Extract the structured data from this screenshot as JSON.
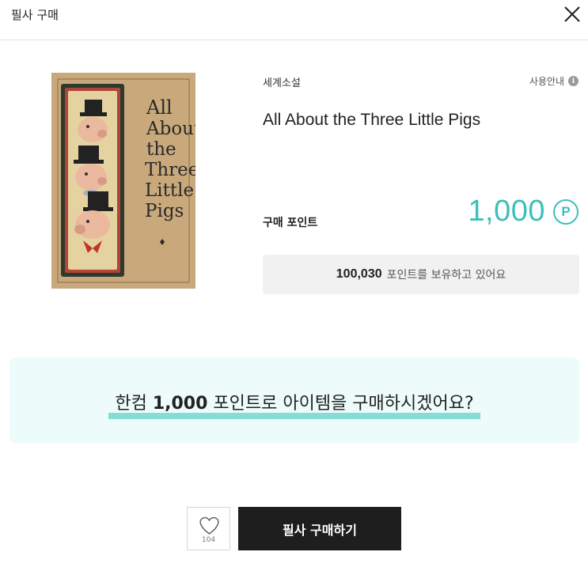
{
  "header": {
    "title": "필사 구매"
  },
  "book": {
    "category": "세계소설",
    "title": "All About the Three Little Pigs",
    "cover_text": [
      "All",
      "About",
      "the",
      "Three",
      "Little",
      "Pigs"
    ]
  },
  "usage_guide": {
    "label": "사용안내",
    "icon": "info-icon"
  },
  "price": {
    "label": "구매 포인트",
    "value": "1,000",
    "currency_symbol": "P"
  },
  "balance": {
    "amount": "100,030",
    "text": "포인트를 보유하고 있어요"
  },
  "confirm": {
    "prefix": "한컴 ",
    "points": "1,000",
    "suffix": " 포인트로 아이템을 구매하시겠어요?"
  },
  "actions": {
    "like_count": "104",
    "buy_label": "필사 구매하기"
  },
  "colors": {
    "accent": "#3dbfba",
    "highlight": "#86dcd6",
    "confirm_bg": "#eefbfb",
    "buy_bg": "#1e1e1e"
  }
}
